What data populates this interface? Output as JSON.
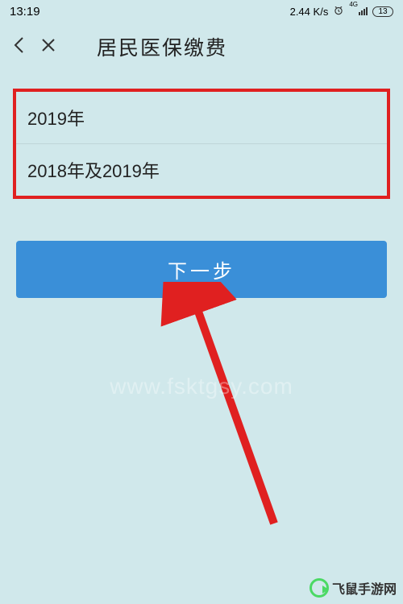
{
  "statusBar": {
    "time": "13:19",
    "speed": "2.44",
    "speedUnit": "K/s",
    "signalLabel": "4G",
    "batteryPercent": "13"
  },
  "header": {
    "title": "居民医保缴费"
  },
  "options": {
    "item1": "2019年",
    "item2": "2018年及2019年"
  },
  "button": {
    "nextLabel": "下一步"
  },
  "watermark": {
    "center": "www.fsktgsy.com",
    "corner": "飞鼠手游网"
  }
}
